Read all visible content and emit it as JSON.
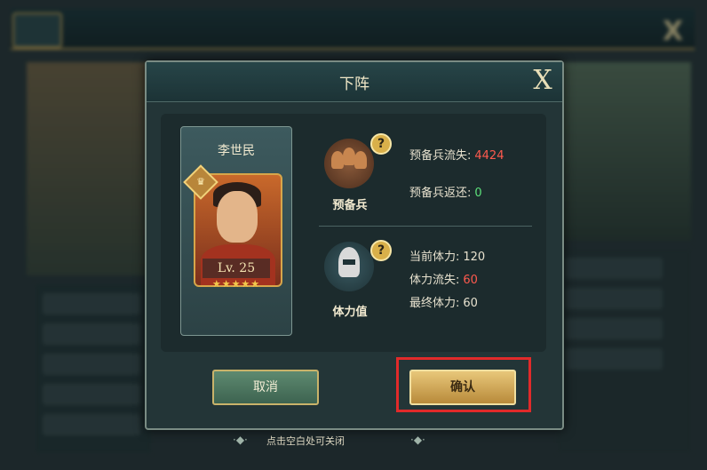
{
  "dialog": {
    "title": "下阵",
    "close_label": "X"
  },
  "hero": {
    "name": "李世民",
    "level": "Lv. 25",
    "stars": "★★★★★"
  },
  "reserve": {
    "caption": "预备兵",
    "loss_label": "预备兵流失:",
    "loss_value": "4424",
    "return_label": "预备兵返还:",
    "return_value": "0"
  },
  "stamina": {
    "caption": "体力值",
    "current_label": "当前体力:",
    "current_value": "120",
    "loss_label": "体力流失:",
    "loss_value": "60",
    "final_label": "最终体力:",
    "final_value": "60"
  },
  "help_label": "?",
  "buttons": {
    "cancel": "取消",
    "confirm": "确认"
  },
  "hint": "点击空白处可关闭",
  "icons": {
    "crown": "crown-icon",
    "help": "help-icon",
    "reserve": "soldier-helmets-icon",
    "stamina": "knight-helmet-icon",
    "close": "close-icon"
  },
  "colors": {
    "loss": "#ff5a4e",
    "gain": "#5ce07a",
    "highlight": "#e12a2a"
  }
}
